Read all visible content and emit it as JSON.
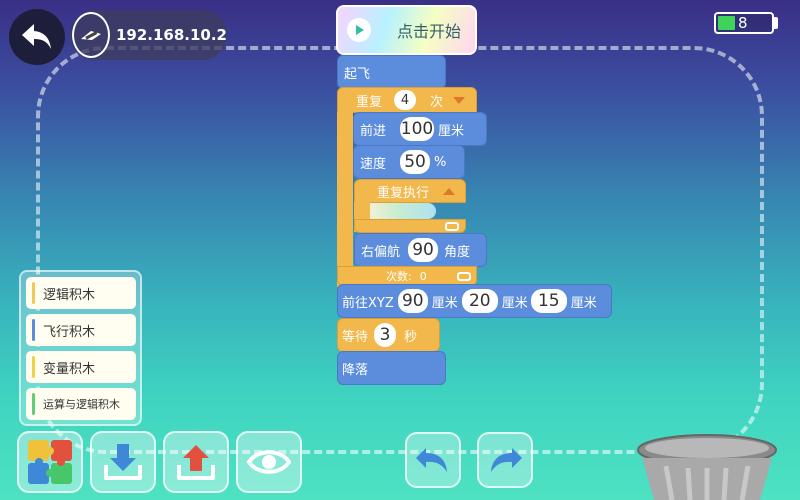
{
  "header": {
    "ip_address": "192.168.10.2",
    "battery_text": "8",
    "battery_level": 0.33
  },
  "program": {
    "start_label": "点击开始",
    "takeoff": "起飞",
    "repeat": {
      "label": "重复",
      "count": "4",
      "suffix": "次"
    },
    "forward": {
      "label": "前进",
      "value": "100",
      "unit": "厘米"
    },
    "speed": {
      "label": "速度",
      "value": "50",
      "unit": "%"
    },
    "repeat_forever": {
      "label": "重复执行"
    },
    "yaw_right": {
      "label": "右偏航",
      "value": "90",
      "unit": "角度"
    },
    "count_text": {
      "label": "次数:",
      "value": "0"
    },
    "goto_xyz": {
      "label": "前往XYZ",
      "x": "90",
      "y": "20",
      "z": "15",
      "unit": "厘米"
    },
    "wait": {
      "label": "等待",
      "value": "3",
      "unit": "秒"
    },
    "land": "降落"
  },
  "palette": {
    "categories": [
      {
        "label": "逻辑积木",
        "color": "#f1c75a"
      },
      {
        "label": "飞行积木",
        "color": "#5b8ddc"
      },
      {
        "label": "变量积木",
        "color": "#f0d24a"
      },
      {
        "label": "运算与逻辑积木",
        "color": "#5fcf73"
      }
    ]
  },
  "toolbar": {
    "icons": [
      "puzzle-icon",
      "download-icon",
      "upload-icon",
      "eye-icon",
      "undo-icon",
      "redo-icon",
      "trash-icon"
    ]
  },
  "colors": {
    "block_blue": "#5b8ddc",
    "block_yellow": "#f2b84b",
    "accent_orange": "#e0782a"
  }
}
